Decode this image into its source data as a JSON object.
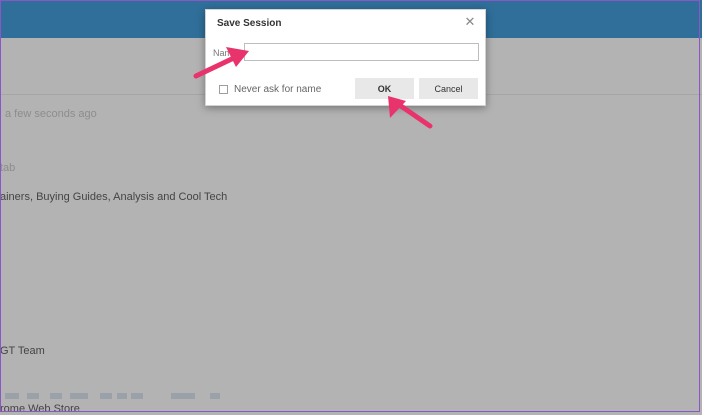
{
  "background": {
    "saved_time": "a few seconds ago",
    "tab_label": "tab",
    "tagline": "ainers, Buying Guides, Analysis and Cool Tech",
    "team": "GT Team",
    "store": "rome Web Store"
  },
  "dialog": {
    "title": "Save Session",
    "close_icon": "close-icon",
    "name_label": "Name",
    "name_value": "",
    "checkbox_label": "Never ask for name",
    "checkbox_checked": false,
    "ok_label": "OK",
    "cancel_label": "Cancel"
  },
  "colors": {
    "topbar": "#2f6f9a",
    "overlay": "#b3b3b3",
    "arrow": "#e8336d"
  }
}
